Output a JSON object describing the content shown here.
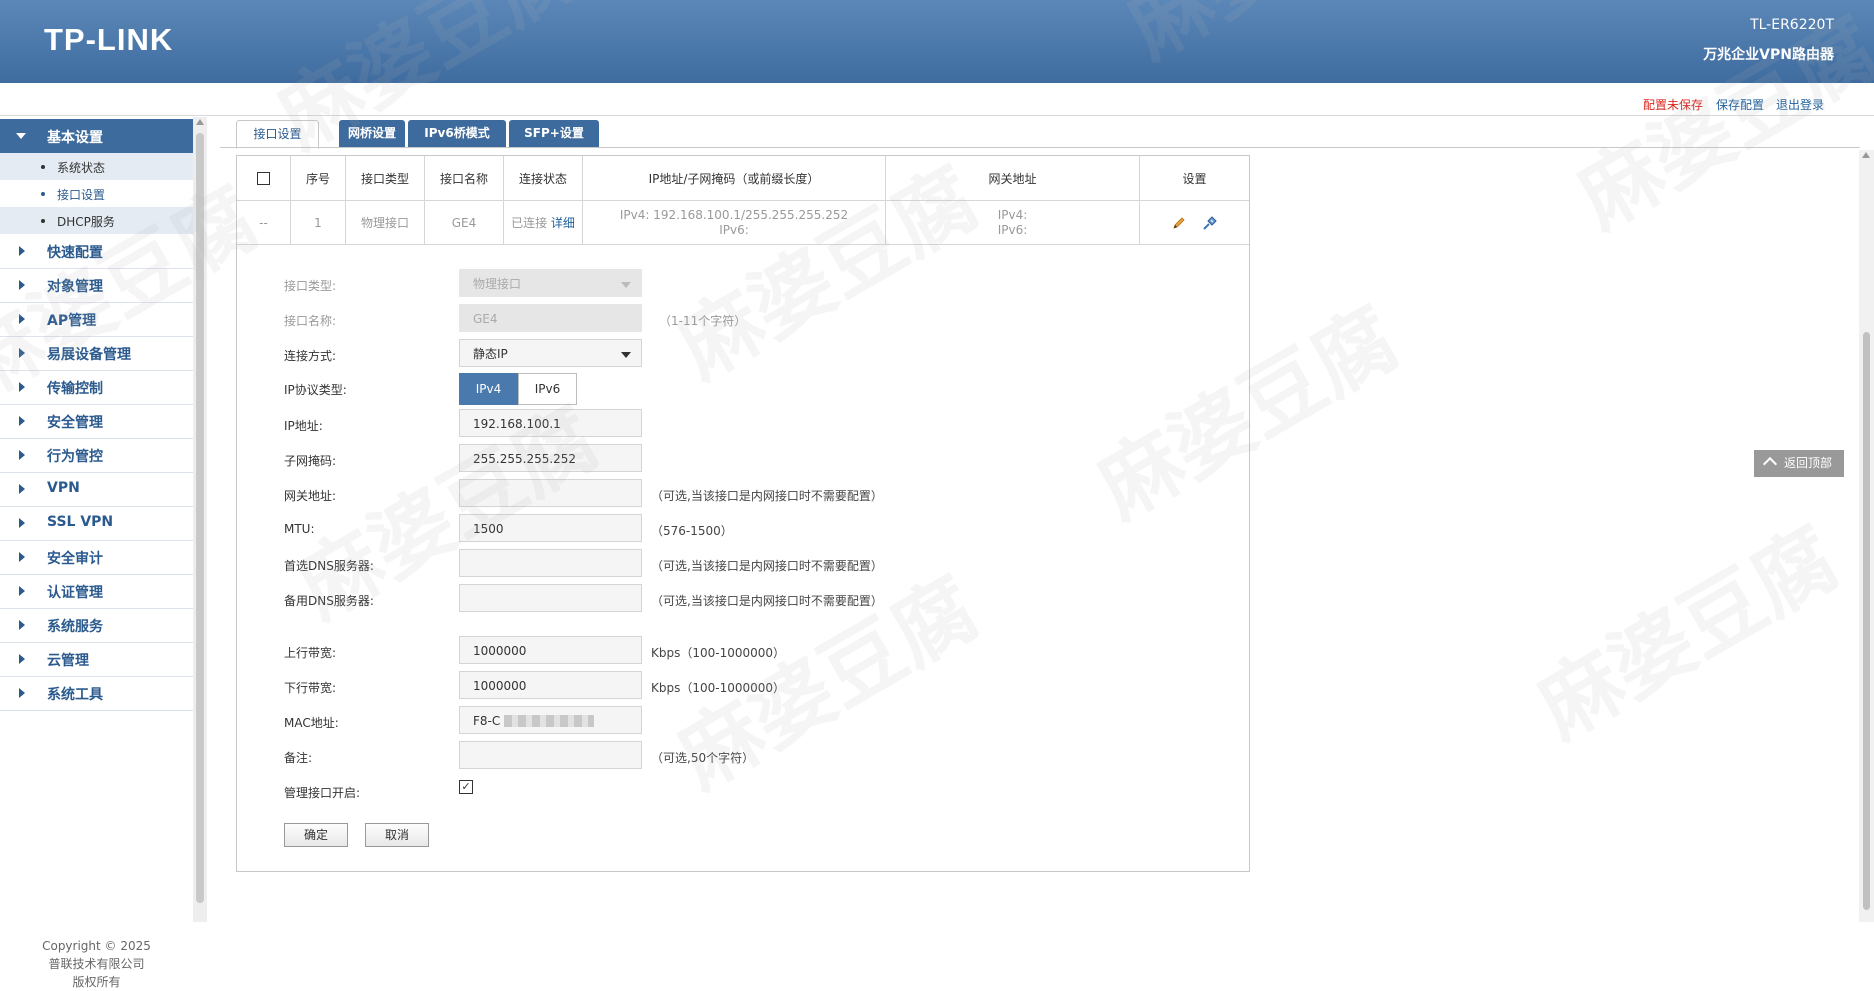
{
  "header": {
    "logo_text": "TP-LINK",
    "model": "TL-ER6220T",
    "model_desc": "万兆企业VPN路由器"
  },
  "topbar": {
    "unsaved": "配置未保存",
    "save": "保存配置",
    "logout": "退出登录"
  },
  "sidebar": {
    "open_group": "基本设置",
    "subitems": [
      "系统状态",
      "接口设置",
      "DHCP服务"
    ],
    "groups": [
      "快速配置",
      "对象管理",
      "AP管理",
      "易展设备管理",
      "传输控制",
      "安全管理",
      "行为管控",
      "VPN",
      "SSL VPN",
      "安全审计",
      "认证管理",
      "系统服务",
      "云管理",
      "系统工具"
    ],
    "copyright": [
      "Copyright © 2025",
      "普联技术有限公司",
      "版权所有"
    ]
  },
  "tabs": [
    "接口设置",
    "网桥设置",
    "IPv6桥模式",
    "SFP+设置"
  ],
  "table": {
    "headers": [
      "序号",
      "接口类型",
      "接口名称",
      "连接状态",
      "IP地址/子网掩码（或前缀长度）",
      "网关地址",
      "设置"
    ],
    "row": {
      "select": "--",
      "index": "1",
      "type": "物理接口",
      "name": "GE4",
      "status": "已连接",
      "detail": "详细",
      "ip_v4": "IPv4:   192.168.100.1/255.255.255.252",
      "ip_v6": "IPv6:",
      "gw_v4": "IPv4:",
      "gw_v6": "IPv6:"
    }
  },
  "form": {
    "iface_type_label": "接口类型:",
    "iface_type_value": "物理接口",
    "iface_name_label": "接口名称:",
    "iface_name_value": "GE4",
    "iface_name_hint": "（1-11个字符）",
    "conn_label": "连接方式:",
    "conn_value": "静态IP",
    "proto_label": "IP协议类型:",
    "proto_options": [
      "IPv4",
      "IPv6"
    ],
    "ip_label": "IP地址:",
    "ip_value": "192.168.100.1",
    "mask_label": "子网掩码:",
    "mask_value": "255.255.255.252",
    "gw_label": "网关地址:",
    "gw_hint": "（可选,当该接口是内网接口时不需要配置）",
    "mtu_label": "MTU:",
    "mtu_value": "1500",
    "mtu_hint": "（576-1500）",
    "dns1_label": "首选DNS服务器:",
    "dns1_hint": "（可选,当该接口是内网接口时不需要配置）",
    "dns2_label": "备用DNS服务器:",
    "dns2_hint": "（可选,当该接口是内网接口时不需要配置）",
    "up_label": "上行带宽:",
    "up_value": "1000000",
    "up_hint": "Kbps（100-1000000）",
    "down_label": "下行带宽:",
    "down_value": "1000000",
    "down_hint": "Kbps（100-1000000）",
    "mac_label": "MAC地址:",
    "mac_value": "F8-C",
    "note_label": "备注:",
    "note_hint": "（可选,50个字符）",
    "mgmt_label": "管理接口开启:",
    "mgmt_checked": "✓",
    "ok": "确定",
    "cancel": "取消"
  },
  "backtop": "返回顶部",
  "watermark": "麻婆豆腐"
}
